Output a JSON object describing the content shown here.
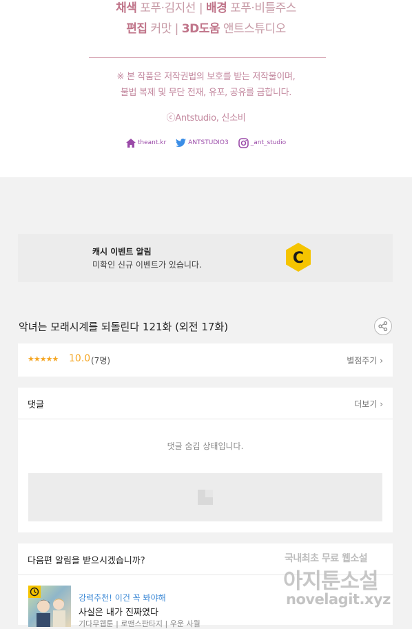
{
  "credits": {
    "line1_label_a": "채색",
    "line1_value_a": "포푸·김지선",
    "line1_label_b": "배경",
    "line1_value_b": "포푸·비틀주스",
    "line2_label_a": "편집",
    "line2_value_a": "커맛",
    "line2_label_b": "3D도움",
    "line2_value_b": "앤트스튜디오",
    "notice_1": "※ 본 작품은 저작권법의 보호를 받는 저작물이며,",
    "notice_2": "불법 복제 및 무단 전재, 유포, 공유를 금합니다.",
    "copyright": "ⓒAntstudio, 신소비",
    "social": {
      "site": "theant.kr",
      "twitter": "ANTSTUDIO3",
      "instagram": "_ant_studio"
    },
    "colors": {
      "accent": "#c0758a",
      "text": "#c79aa6",
      "social": "#9a4aa8"
    }
  },
  "event_banner": {
    "title": "캐시 이벤트 알림",
    "subtitle": "미확인 신규 이벤트가 있습니다.",
    "badge_letter": "C",
    "badge_color": "#f5c400"
  },
  "episode": {
    "title": "악녀는 모래시계를 되돌린다 121화 (외전 17화)"
  },
  "rating": {
    "stars": "★★★★★",
    "score": "10.0",
    "count": "(7명)",
    "rate_label": "별점주기 ›"
  },
  "comments": {
    "header": "댓글",
    "more": "더보기 ›",
    "hidden_message": "댓글 숨김 상태입니다."
  },
  "next_alert": {
    "question": "다음편 알림을 받으시겠습니까?",
    "rec_tag": "강력추천! 이건 꼭 봐야해",
    "rec_title": "사실은 내가 진짜였다",
    "rec_meta": "기다무웹툰 | 로맨스판타지 | 우운 사월"
  },
  "watermark": {
    "line1": "국내최초 무료 웹소설",
    "line2": "아지툰소설",
    "line3": "novelagit.xyz"
  }
}
